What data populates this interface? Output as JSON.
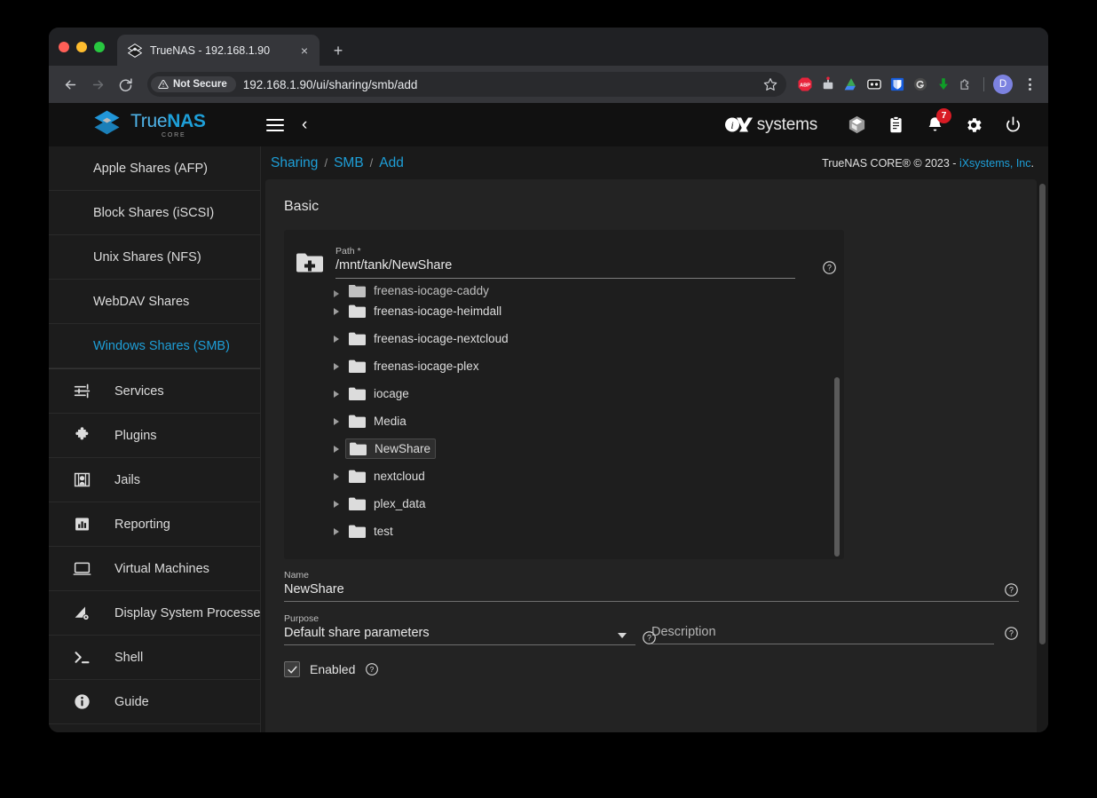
{
  "browser": {
    "tab": {
      "title": "TrueNAS - 192.168.1.90",
      "close_label": "×"
    },
    "new_tab_label": "+",
    "nav": {
      "back": "←",
      "forward": "→",
      "reload": "↻"
    },
    "security_label": "Not Secure",
    "url": "192.168.1.90/ui/sharing/smb/add",
    "profile_initial": "D",
    "extensions": [
      "adblock-plus-icon",
      "wappalyzer-icon",
      "google-drive-icon",
      "lastpass-icon",
      "bitwarden-icon",
      "grammarly-icon",
      "idm-download-icon",
      "extensions-puzzle-icon"
    ]
  },
  "app": {
    "brand": {
      "name_light": "True",
      "name_bold": "NAS",
      "sub": "CORE"
    },
    "vendor": "systems",
    "notifications_count": "7",
    "header_icons": [
      "hamburger-icon",
      "back-chevron-icon",
      "ix-systems-logo",
      "cube-icon",
      "clipboard-icon",
      "bell-icon",
      "gear-icon",
      "power-icon"
    ]
  },
  "sidebar": {
    "items": [
      {
        "label": "Apple Shares (AFP)",
        "icon": "",
        "sub": true,
        "active": false
      },
      {
        "label": "Block Shares (iSCSI)",
        "icon": "",
        "sub": true,
        "active": false
      },
      {
        "label": "Unix Shares (NFS)",
        "icon": "",
        "sub": true,
        "active": false
      },
      {
        "label": "WebDAV Shares",
        "icon": "",
        "sub": true,
        "active": false
      },
      {
        "label": "Windows Shares (SMB)",
        "icon": "",
        "sub": true,
        "active": true
      },
      {
        "label": "Services",
        "icon": "sliders-icon",
        "sub": false,
        "active": false
      },
      {
        "label": "Plugins",
        "icon": "puzzle-icon",
        "sub": false,
        "active": false
      },
      {
        "label": "Jails",
        "icon": "jail-icon",
        "sub": false,
        "active": false
      },
      {
        "label": "Reporting",
        "icon": "bar-chart-icon",
        "sub": false,
        "active": false
      },
      {
        "label": "Virtual Machines",
        "icon": "monitor-icon",
        "sub": false,
        "active": false
      },
      {
        "label": "Display System Processes",
        "icon": "process-icon",
        "sub": false,
        "active": false
      },
      {
        "label": "Shell",
        "icon": "terminal-icon",
        "sub": false,
        "active": false
      },
      {
        "label": "Guide",
        "icon": "info-icon",
        "sub": false,
        "active": false
      }
    ]
  },
  "breadcrumb": {
    "items": [
      "Sharing",
      "SMB",
      "Add"
    ],
    "separator": "/"
  },
  "copyright": {
    "text": "TrueNAS CORE® © 2023 - ",
    "link": "iXsystems, Inc",
    "suffix": "."
  },
  "form": {
    "section_title": "Basic",
    "path": {
      "label": "Path *",
      "value": "/mnt/tank/NewShare",
      "help": "?"
    },
    "tree": [
      {
        "name": "freenas-iocage-caddy",
        "selected": false,
        "clipped": true
      },
      {
        "name": "freenas-iocage-heimdall",
        "selected": false,
        "clipped": false
      },
      {
        "name": "freenas-iocage-nextcloud",
        "selected": false,
        "clipped": false
      },
      {
        "name": "freenas-iocage-plex",
        "selected": false,
        "clipped": false
      },
      {
        "name": "iocage",
        "selected": false,
        "clipped": false
      },
      {
        "name": "Media",
        "selected": false,
        "clipped": false
      },
      {
        "name": "NewShare",
        "selected": true,
        "clipped": false
      },
      {
        "name": "nextcloud",
        "selected": false,
        "clipped": false
      },
      {
        "name": "plex_data",
        "selected": false,
        "clipped": false
      },
      {
        "name": "test",
        "selected": false,
        "clipped": false
      }
    ],
    "name": {
      "label": "Name",
      "value": "NewShare",
      "help": "?"
    },
    "purpose": {
      "label": "Purpose",
      "value": "Default share parameters",
      "help": "?"
    },
    "description": {
      "label": "Description",
      "placeholder": "Description",
      "value": "",
      "help": "?"
    },
    "enabled": {
      "label": "Enabled",
      "checked": true,
      "help": "?"
    }
  }
}
